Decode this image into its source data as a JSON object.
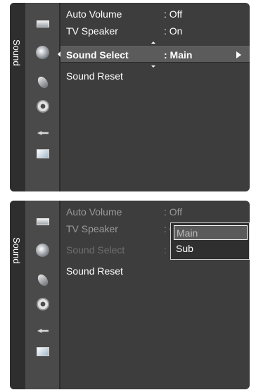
{
  "side_tab": {
    "label": "Sound"
  },
  "icons": [
    "picture-icon",
    "sound-icon",
    "channel-icon",
    "setup-icon",
    "input-icon",
    "application-icon"
  ],
  "panel1": {
    "items": [
      {
        "label": "Auto Volume",
        "value": ": Off"
      },
      {
        "label": "TV Speaker",
        "value": ": On"
      },
      {
        "label": "Sound Select",
        "value": ": Main"
      },
      {
        "label": "Sound Reset",
        "value": ""
      }
    ]
  },
  "panel2": {
    "items": [
      {
        "label": "Auto Volume",
        "value": ": Off"
      },
      {
        "label": "TV Speaker",
        "value": ": On"
      },
      {
        "label": "Sound Select",
        "value": ":"
      },
      {
        "label": "Sound Reset",
        "value": ""
      }
    ],
    "dropdown": {
      "options": [
        "Main",
        "Sub"
      ],
      "selected": "Main"
    }
  }
}
